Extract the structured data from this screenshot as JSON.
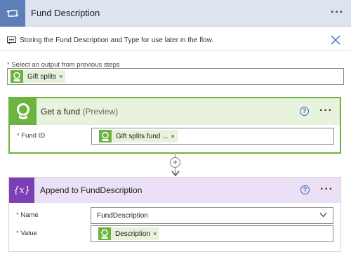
{
  "header": {
    "title": "Fund Description",
    "menu_label": "···"
  },
  "comment": {
    "text": "Storing the Fund Description and Type for use later in the flow."
  },
  "select_output": {
    "label": "Select an output from previous steps",
    "required_mark": "*",
    "token_label": "Gift splits",
    "token_remove": "×"
  },
  "get_fund": {
    "title": "Get a fund",
    "badge": "(Preview)",
    "help": "?",
    "menu_label": "···",
    "field_label": "Fund ID",
    "required_mark": "*",
    "token_label": "Gift splits fund ...",
    "token_remove": "×"
  },
  "connector": {
    "plus": "+"
  },
  "append": {
    "title": "Append to FundDescription",
    "icon_text": "{x}",
    "help": "?",
    "menu_label": "···",
    "name_label": "Name",
    "name_value": "FundDescription",
    "value_label": "Value",
    "required_mark": "*",
    "token_label": "Description",
    "token_remove": "×"
  },
  "colors": {
    "header_bg": "#dde3ef",
    "header_icon": "#5c7fb8",
    "fund_green": "#6cb33f",
    "variable_purple": "#7c3fb5",
    "required_red": "#c4314b",
    "help_blue": "#3c67c0"
  }
}
